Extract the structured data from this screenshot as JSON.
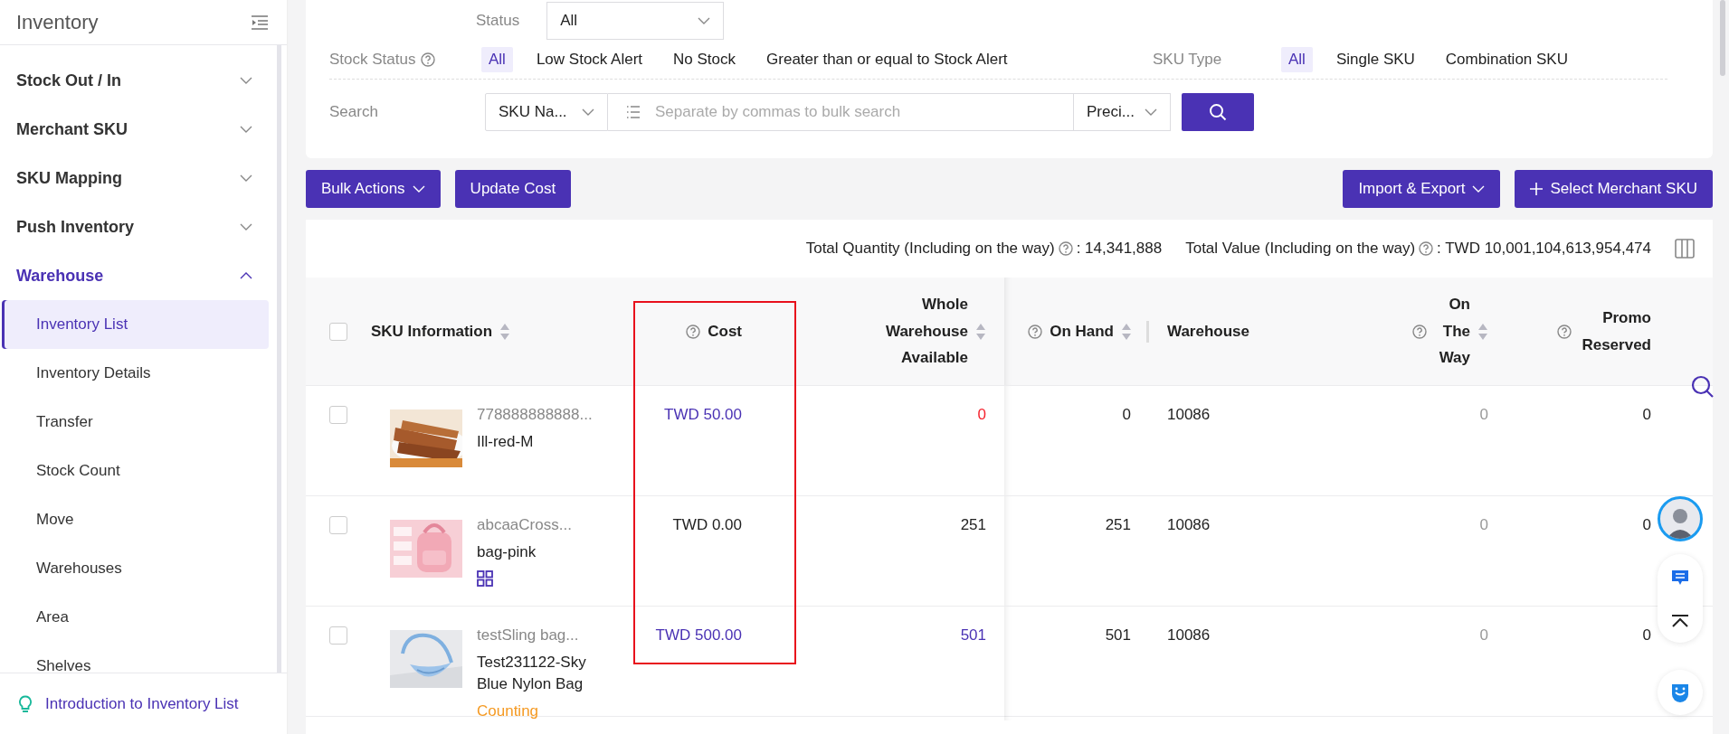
{
  "sidebar": {
    "title": "Inventory",
    "items": [
      {
        "label": "Stock Out / In",
        "expanded": false
      },
      {
        "label": "Merchant SKU",
        "expanded": false
      },
      {
        "label": "SKU Mapping",
        "expanded": false
      },
      {
        "label": "Push Inventory",
        "expanded": false
      },
      {
        "label": "Warehouse",
        "expanded": true,
        "children": [
          {
            "label": "Inventory List",
            "selected": true
          },
          {
            "label": "Inventory Details",
            "selected": false
          },
          {
            "label": "Transfer",
            "selected": false
          },
          {
            "label": "Stock Count",
            "selected": false
          },
          {
            "label": "Move",
            "selected": false
          },
          {
            "label": "Warehouses",
            "selected": false
          },
          {
            "label": "Area",
            "selected": false
          },
          {
            "label": "Shelves",
            "selected": false
          }
        ]
      }
    ],
    "footer_link": "Introduction to Inventory List"
  },
  "filters": {
    "status": {
      "label": "Status",
      "value": "All"
    },
    "stock_status": {
      "label": "Stock Status",
      "options": [
        {
          "label": "All",
          "selected": true
        },
        {
          "label": "Low Stock Alert",
          "selected": false
        },
        {
          "label": "No Stock",
          "selected": false
        },
        {
          "label": "Greater than or equal to Stock Alert",
          "selected": false
        }
      ]
    },
    "sku_type": {
      "label": "SKU Type",
      "options": [
        {
          "label": "All",
          "selected": true
        },
        {
          "label": "Single SKU",
          "selected": false
        },
        {
          "label": "Combination SKU",
          "selected": false
        }
      ]
    },
    "search": {
      "label": "Search",
      "field": "SKU Na...",
      "placeholder": "Separate by commas to bulk search",
      "match": "Preci..."
    }
  },
  "toolbar": {
    "left": [
      {
        "label": "Bulk Actions",
        "kind": "dropdown"
      },
      {
        "label": "Update Cost",
        "kind": "plain"
      }
    ],
    "right": [
      {
        "label": "Import & Export",
        "kind": "dropdown"
      },
      {
        "label": "Select Merchant SKU",
        "kind": "add"
      }
    ]
  },
  "totals": [
    {
      "label": "Total Quantity (Including on the way)",
      "value": ": 14,341,888"
    },
    {
      "label": "Total Value (Including on the way)",
      "value": ": TWD 10,001,104,613,954,474"
    }
  ],
  "table": {
    "all_selected": false,
    "columns": [
      {
        "label": "SKU Information",
        "help": false,
        "sortable": true,
        "highlighted": false
      },
      {
        "label": "Cost",
        "help": true,
        "sortable": false,
        "highlighted": true
      },
      {
        "label": "Whole Warehouse Available",
        "help": false,
        "sortable": true,
        "highlighted": false
      },
      {
        "label": "On Hand",
        "help": true,
        "sortable": true,
        "highlighted": false
      },
      {
        "label": "Warehouse",
        "help": false,
        "sortable": false,
        "highlighted": false
      },
      {
        "label": "On The Way",
        "help": true,
        "sortable": true,
        "highlighted": false
      },
      {
        "label": "Promo Reserved",
        "help": true,
        "sortable": false,
        "highlighted": false
      }
    ],
    "rows": [
      {
        "selected": false,
        "cells": [
          {
            "kind": "sku",
            "sku_code": "778888888888...",
            "sku_name": "Ill-red-M",
            "combination": false
          },
          {
            "text": "TWD 50.00",
            "color": "#4a32b4"
          },
          {
            "text": "0",
            "color": "#f5222d"
          },
          {
            "text": "0",
            "color": "#222222"
          },
          {
            "text": "10086",
            "color": "#222222"
          },
          {
            "text": "0",
            "color": "#999999"
          },
          {
            "text": "0",
            "color": "#222222"
          }
        ]
      },
      {
        "selected": false,
        "cells": [
          {
            "kind": "sku",
            "sku_code": "abcaaCross...",
            "sku_name": "bag-pink",
            "combination": true
          },
          {
            "text": "TWD 0.00",
            "color": "#222222"
          },
          {
            "text": "251",
            "color": "#222222"
          },
          {
            "text": "251",
            "color": "#222222"
          },
          {
            "text": "10086",
            "color": "#222222"
          },
          {
            "text": "0",
            "color": "#999999"
          },
          {
            "text": "0",
            "color": "#222222"
          }
        ]
      },
      {
        "selected": false,
        "cells": [
          {
            "kind": "sku",
            "sku_code": "testSling bag...",
            "sku_name": "Test231122-Sky Blue Nylon Bag",
            "combination": false,
            "tag": "Counting"
          },
          {
            "text": "TWD 500.00",
            "color": "#4a32b4"
          },
          {
            "text": "501",
            "color": "#4a32b4"
          },
          {
            "text": "501",
            "color": "#222222"
          },
          {
            "text": "10086",
            "color": "#222222"
          },
          {
            "text": "0",
            "color": "#999999"
          },
          {
            "text": "0",
            "color": "#222222"
          }
        ]
      }
    ]
  }
}
